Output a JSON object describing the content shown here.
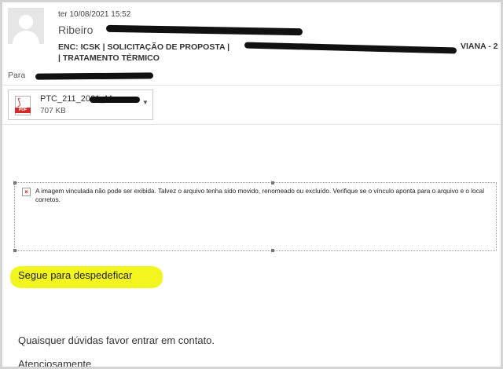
{
  "header": {
    "date": "ter 10/08/2021 15:52",
    "sender": "Ribeiro",
    "subject_line1": "ENC: ICSK | SOLICITAÇÃO DE PROPOSTA |",
    "subject_tail": "VIANA - 2",
    "subject_line2": "| TRATAMENTO TÉRMICO",
    "to_label": "Para"
  },
  "attachment": {
    "name": "PTC_211_2021_M",
    "size": "707 KB",
    "type_label": "PDF",
    "icon": "pdf-icon",
    "menu_icon": "chevron-down-icon"
  },
  "image_placeholder": {
    "icon": "broken-image-icon",
    "message": "A imagem vinculada não pode ser exibida. Talvez o arquivo tenha sido movido, renomeado ou excluído. Verifique se o vínculo aponta para o arquivo e o local corretos."
  },
  "body": {
    "line1": "Segue para despedeficar",
    "line2": "Quaisquer dúvidas favor entrar em contato.",
    "line3": "Atenciosamente"
  },
  "colors": {
    "highlight": "#f2f51e",
    "pdf_red": "#d42a2a",
    "redaction": "#111111"
  }
}
